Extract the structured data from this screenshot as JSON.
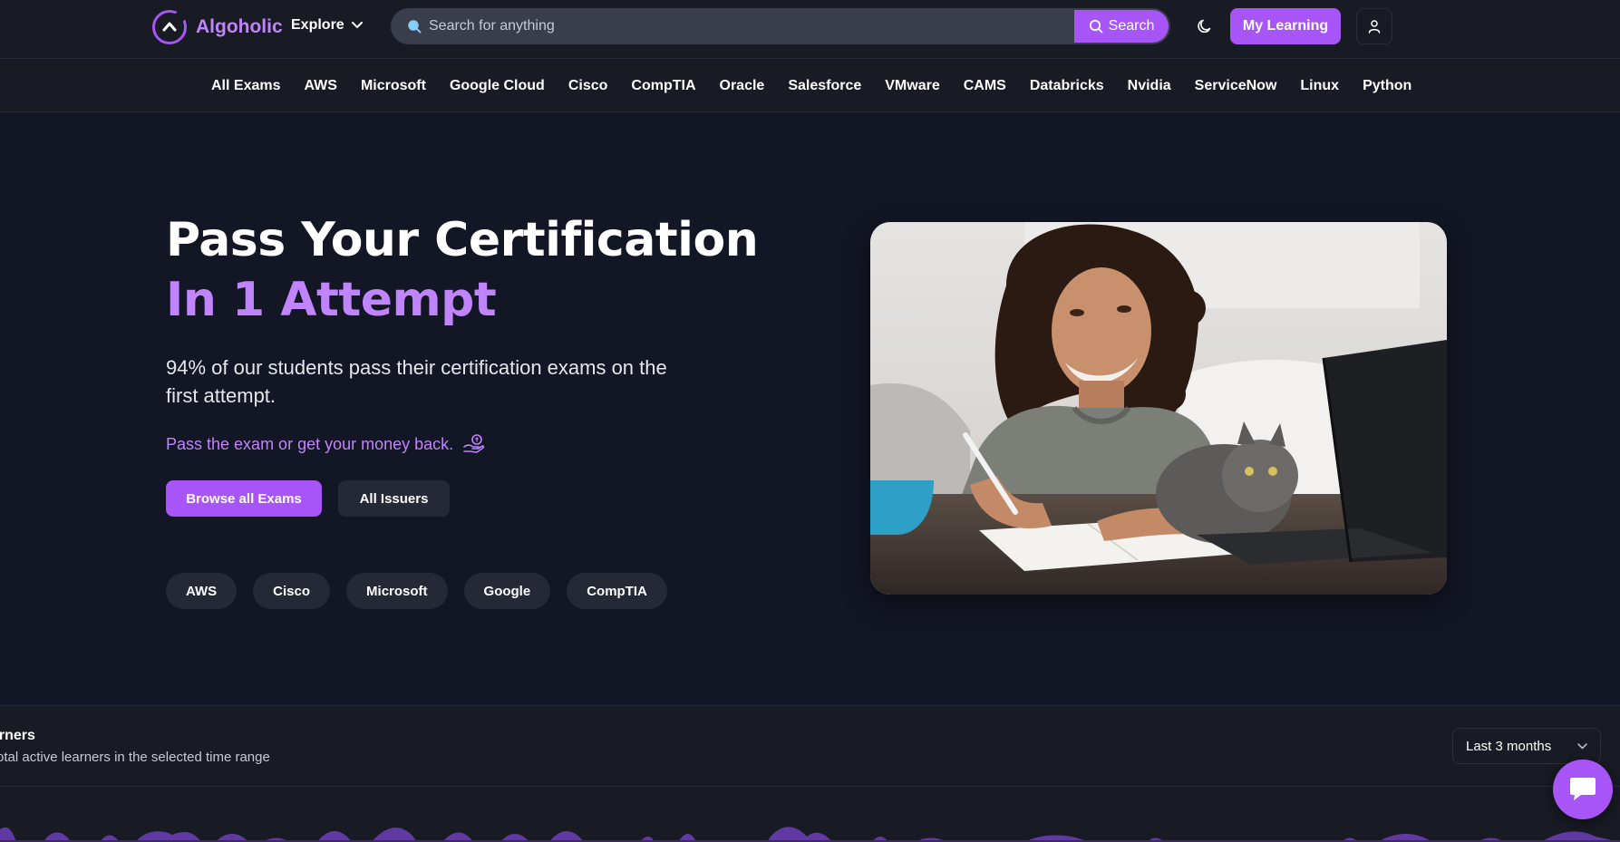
{
  "header": {
    "brand": "Algoholic",
    "explore_label": "Explore",
    "search_placeholder": "Search for anything",
    "search_button": "Search",
    "my_learning_label": "My Learning"
  },
  "categories": [
    "All Exams",
    "AWS",
    "Microsoft",
    "Google Cloud",
    "Cisco",
    "CompTIA",
    "Oracle",
    "Salesforce",
    "VMware",
    "CAMS",
    "Databricks",
    "Nvidia",
    "ServiceNow",
    "Linux",
    "Python"
  ],
  "hero": {
    "title_line1": "Pass Your Certification",
    "title_line2": "In 1 Attempt",
    "subtitle": "94% of our students pass their certification exams on the first attempt.",
    "guarantee": "Pass the exam or get your money back.",
    "primary_button": "Browse all Exams",
    "secondary_button": "All Issuers",
    "pills": [
      "AWS",
      "Cisco",
      "Microsoft",
      "Google",
      "CompTIA"
    ]
  },
  "stats": {
    "title": "arners",
    "description": "otal active learners in the selected time range",
    "range_selected": "Last 3 months"
  },
  "colors": {
    "background": "#131624",
    "header_bg": "#181a24",
    "accent": "#a855f7",
    "accent_text": "#c084fc",
    "pill_bg": "#252835"
  },
  "icons": {
    "logo": "algoholic-logo-icon",
    "search": "search-icon",
    "theme": "moon-icon",
    "user": "user-icon",
    "guarantee": "money-hand-icon",
    "chevron": "chevron-down-icon",
    "chat": "chat-icon"
  }
}
